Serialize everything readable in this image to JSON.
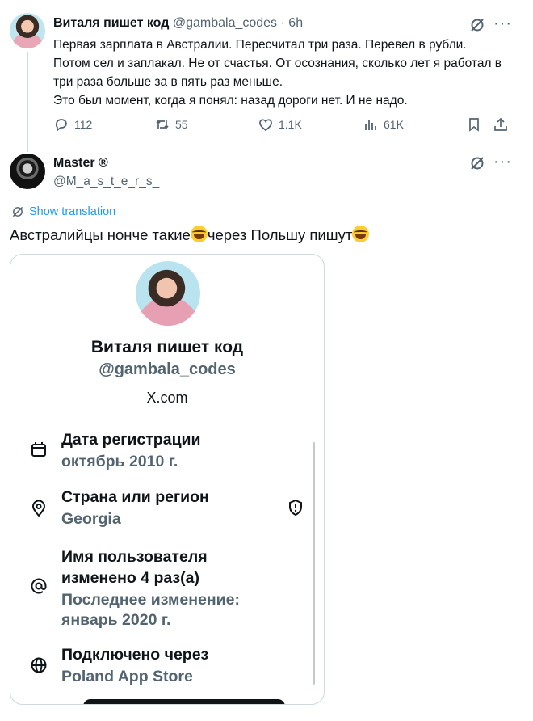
{
  "tweet1": {
    "author_name": "Виталя пишет код",
    "handle": "@gambala_codes",
    "time": "· 6h",
    "lines": [
      "Первая зарплата в Австралии. Пересчитал три раза. Перевел в рубли.",
      "Потом сел и заплакал. Не от счастья. От осознания, сколько лет я работал в",
      "три раза больше за в пять раз меньше.",
      "Это был момент, когда я понял: назад дороги нет. И не надо."
    ],
    "replies": "112",
    "reposts": "55",
    "likes": "1.1K",
    "views": "61K"
  },
  "tweet2": {
    "author_name": "Master ®",
    "handle": "@M_a_s_t_e_r_s_",
    "show_translation": "Show translation",
    "text_part1": "Австралийцы нонче такие",
    "text_part2": "через Польшу пишут"
  },
  "card": {
    "name": "Виталя пишет код",
    "handle": "@gambala_codes",
    "x_domain": "X.com",
    "rows": [
      {
        "label": "Дата регистрации",
        "value": "октябрь 2010 г.",
        "icon": "calendar-icon"
      },
      {
        "label": "Страна или регион",
        "value": "Georgia",
        "icon": "location-pin-icon"
      },
      {
        "label1": "Имя пользователя",
        "label2": "изменено 4 раз(а)",
        "value1": "Последнее изменение:",
        "value2": "январь 2020 г.",
        "icon": "at-sign-icon"
      },
      {
        "label": "Подключено через",
        "value": "Poland App Store",
        "icon": "globe-icon"
      }
    ]
  },
  "colors": {
    "text": "#0f1419",
    "secondary": "#536471",
    "link": "#1d9bf0",
    "border": "#cfd9de"
  }
}
